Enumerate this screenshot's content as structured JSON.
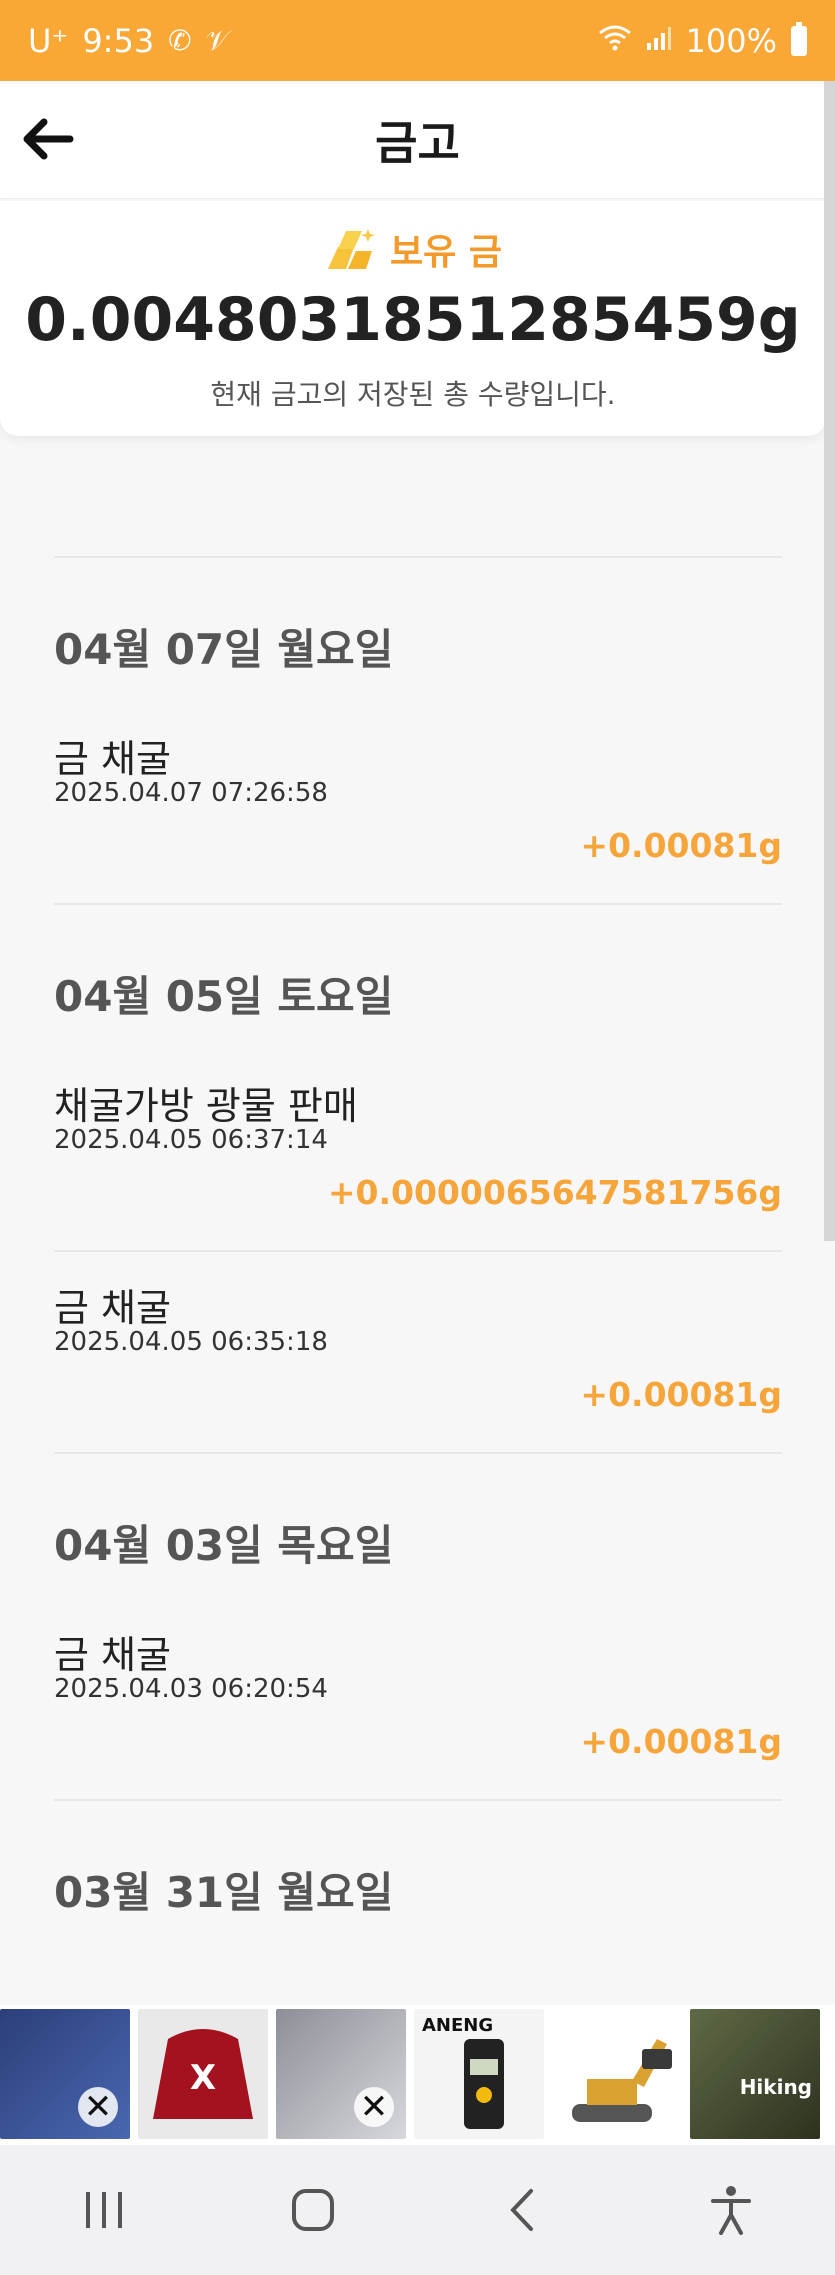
{
  "status_bar": {
    "carrier": "U⁺",
    "time": "9:53",
    "battery": "100%"
  },
  "header": {
    "title": "금고"
  },
  "summary": {
    "label": "보유 금",
    "total": "0.0048031851285459g",
    "description": "현재 금고의 저장된 총 수량입니다."
  },
  "groups": [
    {
      "date": "04월 07일 월요일",
      "entries": [
        {
          "title": "금 채굴",
          "time": "2025.04.07 07:26:58",
          "amount": "+0.00081g"
        }
      ]
    },
    {
      "date": "04월 05일 토요일",
      "entries": [
        {
          "title": "채굴가방 광물 판매",
          "time": "2025.04.05 06:37:14",
          "amount": "+0.0000065647581756g"
        },
        {
          "title": "금 채굴",
          "time": "2025.04.05 06:35:18",
          "amount": "+0.00081g"
        }
      ]
    },
    {
      "date": "04월 03일 목요일",
      "entries": [
        {
          "title": "금 채굴",
          "time": "2025.04.03 06:20:54",
          "amount": "+0.00081g"
        }
      ]
    },
    {
      "date": "03월 31일 월요일",
      "entries": []
    }
  ],
  "ads": {
    "item3_text": "ANENG",
    "item6_text": "Hiking"
  },
  "colors": {
    "accent": "#f9a735",
    "amount": "#f5a53a"
  }
}
